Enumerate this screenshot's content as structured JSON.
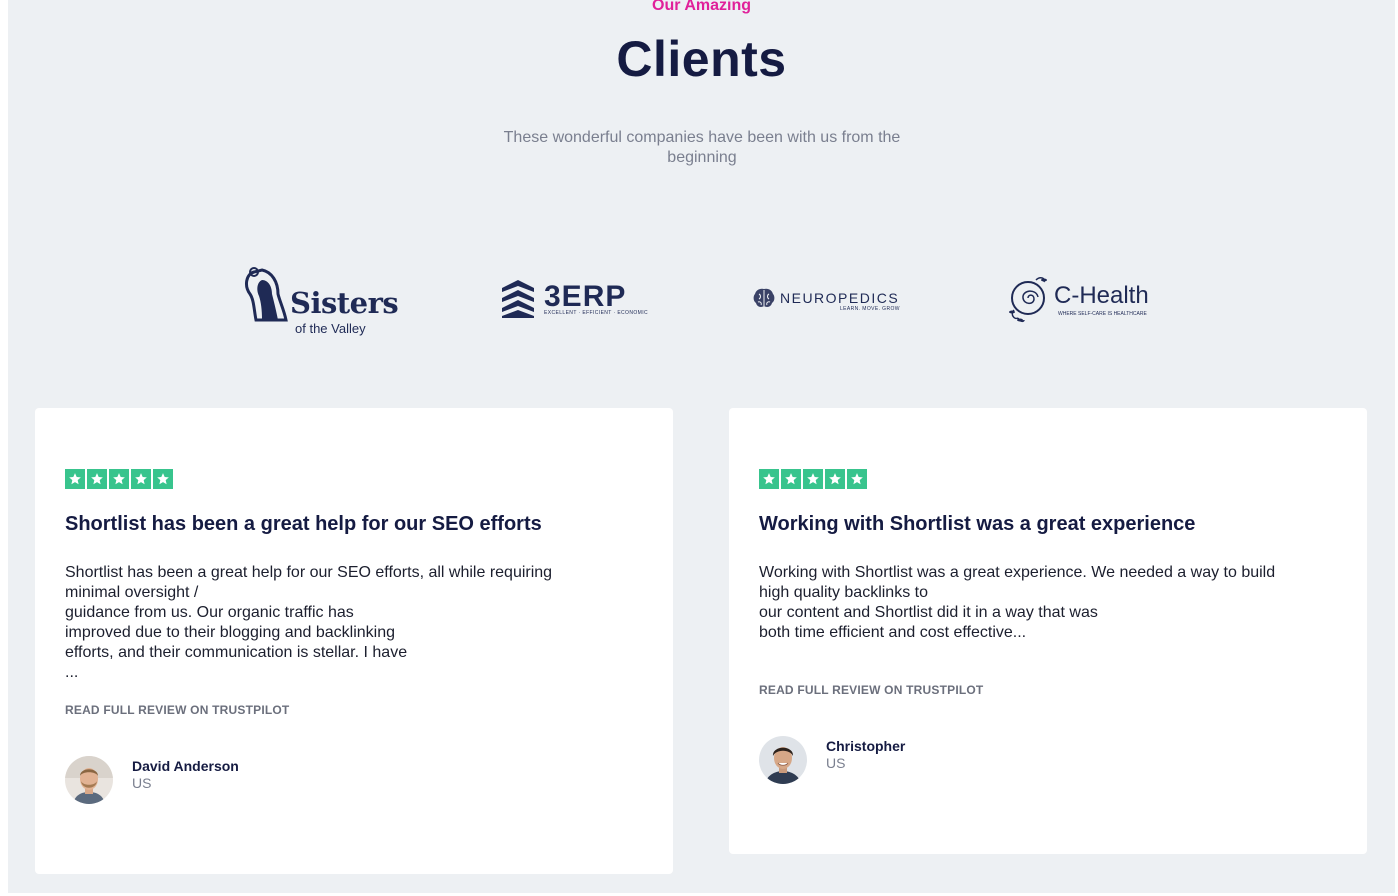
{
  "section": {
    "eyebrow": "Our Amazing",
    "title": "Clients",
    "subtitle": "These wonderful companies have been with us from the beginning"
  },
  "logos": [
    {
      "name": "Sisters",
      "tagline": "of the Valley",
      "icon": "sister-silhouette-icon"
    },
    {
      "name": "3ERP",
      "tagline": "EXCELLENT · EFFICIENT · ECONOMIC",
      "icon": "stacked-chevron-icon"
    },
    {
      "name": "NEUROPEDICS",
      "tagline": "LEARN. MOVE. GROW",
      "icon": "brain-icon"
    },
    {
      "name": "C-Health",
      "tagline": "WHERE SELF-CARE IS HEALTHCARE",
      "icon": "spiral-leaf-icon"
    }
  ],
  "reviews": [
    {
      "rating": 5,
      "title": "Shortlist has been a great help for our SEO efforts",
      "body_lines": [
        "Shortlist has been a great help for our SEO efforts, all while requiring",
        "minimal oversight /",
        "guidance from us. Our organic traffic has",
        "improved due to their blogging and backlinking",
        "efforts, and their communication is stellar. I have",
        "..."
      ],
      "link_label": "READ FULL REVIEW ON TRUSTPILOT",
      "author": "David Anderson",
      "country": "US"
    },
    {
      "rating": 5,
      "title": "Working with Shortlist was a great experience",
      "body_lines": [
        "Working with Shortlist was a great experience. We needed a way to build",
        "high quality backlinks to",
        "our content and Shortlist did it in a way that was",
        "both time efficient and cost effective..."
      ],
      "link_label": "READ FULL REVIEW ON TRUSTPILOT",
      "author": "Christopher",
      "country": "US"
    }
  ],
  "colors": {
    "accent": "#e0219a",
    "heading": "#151b42",
    "background": "#edf0f3",
    "star": "#38c48d",
    "logo": "#1f2a55"
  }
}
